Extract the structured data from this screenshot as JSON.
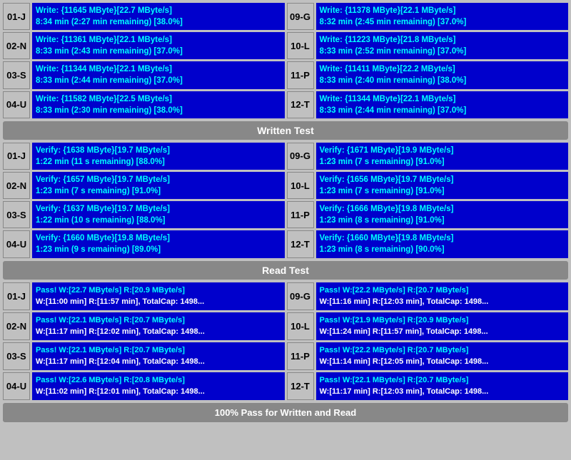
{
  "sections": {
    "write": {
      "header": "Written Test",
      "rows_left": [
        {
          "id": "01-J",
          "line1": "Write: {11645 MByte}[22.7 MByte/s]",
          "line2": "8:34 min (2:27 min remaining)  [38.0%]"
        },
        {
          "id": "02-N",
          "line1": "Write: {11361 MByte}[22.1 MByte/s]",
          "line2": "8:33 min (2:43 min remaining)  [37.0%]"
        },
        {
          "id": "03-S",
          "line1": "Write: {11344 MByte}[22.1 MByte/s]",
          "line2": "8:33 min (2:44 min remaining)  [37.0%]"
        },
        {
          "id": "04-U",
          "line1": "Write: {11582 MByte}[22.5 MByte/s]",
          "line2": "8:33 min (2:30 min remaining)  [38.0%]"
        }
      ],
      "rows_right": [
        {
          "id": "09-G",
          "line1": "Write: {11378 MByte}[22.1 MByte/s]",
          "line2": "8:32 min (2:45 min remaining)  [37.0%]"
        },
        {
          "id": "10-L",
          "line1": "Write: {11223 MByte}[21.8 MByte/s]",
          "line2": "8:33 min (2:52 min remaining)  [37.0%]"
        },
        {
          "id": "11-P",
          "line1": "Write: {11411 MByte}[22.2 MByte/s]",
          "line2": "8:33 min (2:40 min remaining)  [38.0%]"
        },
        {
          "id": "12-T",
          "line1": "Write: {11344 MByte}[22.1 MByte/s]",
          "line2": "8:33 min (2:44 min remaining)  [37.0%]"
        }
      ]
    },
    "verify": {
      "header": "Written Test",
      "rows_left": [
        {
          "id": "01-J",
          "line1": "Verify: {1638 MByte}[19.7 MByte/s]",
          "line2": "1:22 min (11 s remaining)   [88.0%]"
        },
        {
          "id": "02-N",
          "line1": "Verify: {1657 MByte}[19.7 MByte/s]",
          "line2": "1:23 min (7 s remaining)   [91.0%]"
        },
        {
          "id": "03-S",
          "line1": "Verify: {1637 MByte}[19.7 MByte/s]",
          "line2": "1:22 min (10 s remaining)   [88.0%]"
        },
        {
          "id": "04-U",
          "line1": "Verify: {1660 MByte}[19.8 MByte/s]",
          "line2": "1:23 min (9 s remaining)   [89.0%]"
        }
      ],
      "rows_right": [
        {
          "id": "09-G",
          "line1": "Verify: {1671 MByte}[19.9 MByte/s]",
          "line2": "1:23 min (7 s remaining)   [91.0%]"
        },
        {
          "id": "10-L",
          "line1": "Verify: {1656 MByte}[19.7 MByte/s]",
          "line2": "1:23 min (7 s remaining)   [91.0%]"
        },
        {
          "id": "11-P",
          "line1": "Verify: {1666 MByte}[19.8 MByte/s]",
          "line2": "1:23 min (8 s remaining)   [91.0%]"
        },
        {
          "id": "12-T",
          "line1": "Verify: {1660 MByte}[19.8 MByte/s]",
          "line2": "1:23 min (8 s remaining)   [90.0%]"
        }
      ]
    },
    "read": {
      "header": "Read Test",
      "rows_left": [
        {
          "id": "01-J",
          "line1": "Pass! W:[22.7 MByte/s] R:[20.9 MByte/s]",
          "line2": "W:[11:00 min] R:[11:57 min], TotalCap: 1498..."
        },
        {
          "id": "02-N",
          "line1": "Pass! W:[22.1 MByte/s] R:[20.7 MByte/s]",
          "line2": "W:[11:17 min] R:[12:02 min], TotalCap: 1498..."
        },
        {
          "id": "03-S",
          "line1": "Pass! W:[22.1 MByte/s] R:[20.7 MByte/s]",
          "line2": "W:[11:17 min] R:[12:04 min], TotalCap: 1498..."
        },
        {
          "id": "04-U",
          "line1": "Pass! W:[22.6 MByte/s] R:[20.8 MByte/s]",
          "line2": "W:[11:02 min] R:[12:01 min], TotalCap: 1498..."
        }
      ],
      "rows_right": [
        {
          "id": "09-G",
          "line1": "Pass! W:[22.2 MByte/s] R:[20.7 MByte/s]",
          "line2": "W:[11:16 min] R:[12:03 min], TotalCap: 1498..."
        },
        {
          "id": "10-L",
          "line1": "Pass! W:[21.9 MByte/s] R:[20.9 MByte/s]",
          "line2": "W:[11:24 min] R:[11:57 min], TotalCap: 1498..."
        },
        {
          "id": "11-P",
          "line1": "Pass! W:[22.2 MByte/s] R:[20.7 MByte/s]",
          "line2": "W:[11:14 min] R:[12:05 min], TotalCap: 1498..."
        },
        {
          "id": "12-T",
          "line1": "Pass! W:[22.1 MByte/s] R:[20.7 MByte/s]",
          "line2": "W:[11:17 min] R:[12:03 min], TotalCap: 1498..."
        }
      ]
    }
  },
  "write_header_label": "Written Test",
  "read_header_label": "Read Test",
  "bottom_banner": "100% Pass for Written and Read"
}
